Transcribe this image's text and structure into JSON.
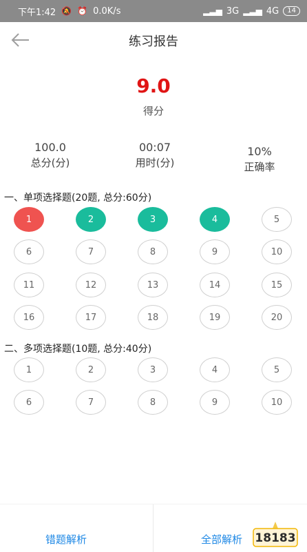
{
  "status_bar": {
    "time": "下午1:42",
    "speed": "0.0K/s",
    "network_3g": "3G",
    "network_4g": "4G",
    "battery": "14"
  },
  "header": {
    "title": "练习报告"
  },
  "score": {
    "value": "9.0",
    "label": "得分"
  },
  "stats": [
    {
      "value": "100.0",
      "label": "总分(分)"
    },
    {
      "value": "00:07",
      "label": "用时(分)"
    },
    {
      "value": "10%",
      "label": "正确率"
    }
  ],
  "sections": [
    {
      "title": "一、单项选择题(20题, 总分:60分)",
      "questions": [
        {
          "num": "1",
          "state": "wrong"
        },
        {
          "num": "2",
          "state": "right"
        },
        {
          "num": "3",
          "state": "right"
        },
        {
          "num": "4",
          "state": "right"
        },
        {
          "num": "5",
          "state": "none"
        },
        {
          "num": "6",
          "state": "none"
        },
        {
          "num": "7",
          "state": "none"
        },
        {
          "num": "8",
          "state": "none"
        },
        {
          "num": "9",
          "state": "none"
        },
        {
          "num": "10",
          "state": "none"
        },
        {
          "num": "11",
          "state": "none"
        },
        {
          "num": "12",
          "state": "none"
        },
        {
          "num": "13",
          "state": "none"
        },
        {
          "num": "14",
          "state": "none"
        },
        {
          "num": "15",
          "state": "none"
        },
        {
          "num": "16",
          "state": "none"
        },
        {
          "num": "17",
          "state": "none"
        },
        {
          "num": "18",
          "state": "none"
        },
        {
          "num": "19",
          "state": "none"
        },
        {
          "num": "20",
          "state": "none"
        }
      ]
    },
    {
      "title": "二、多项选择题(10题, 总分:40分)",
      "questions": [
        {
          "num": "1",
          "state": "none"
        },
        {
          "num": "2",
          "state": "none"
        },
        {
          "num": "3",
          "state": "none"
        },
        {
          "num": "4",
          "state": "none"
        },
        {
          "num": "5",
          "state": "none"
        },
        {
          "num": "6",
          "state": "none"
        },
        {
          "num": "7",
          "state": "none"
        },
        {
          "num": "8",
          "state": "none"
        },
        {
          "num": "9",
          "state": "none"
        },
        {
          "num": "10",
          "state": "none"
        }
      ]
    }
  ],
  "bottom": {
    "wrong_analysis": "错题解析",
    "all_analysis": "全部解析"
  },
  "logo": {
    "text": "18183"
  },
  "colors": {
    "wrong": "#ef5350",
    "right": "#1abc9c",
    "score": "#e01515",
    "link": "#1e88e5"
  }
}
